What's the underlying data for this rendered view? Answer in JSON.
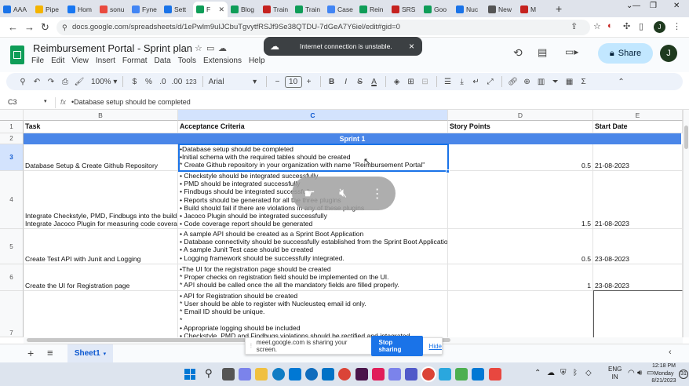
{
  "browser": {
    "tabs": [
      {
        "label": "AAA",
        "color": "#1a73e8"
      },
      {
        "label": "Pipe",
        "color": "#f4b400"
      },
      {
        "label": "Hom",
        "color": "#1877f2"
      },
      {
        "label": "sonu",
        "color": "#e94a3f"
      },
      {
        "label": "Fyne",
        "color": "#4285f4"
      },
      {
        "label": "Sett",
        "color": "#1a73e8"
      },
      {
        "label": "F",
        "color": "#0f9d58",
        "active": true
      },
      {
        "label": "Blog",
        "color": "#0f9d58"
      },
      {
        "label": "Train",
        "color": "#c5221f"
      },
      {
        "label": "Train",
        "color": "#0f9d58"
      },
      {
        "label": "Case",
        "color": "#4285f4"
      },
      {
        "label": "Rein",
        "color": "#0f9d58"
      },
      {
        "label": "SRS",
        "color": "#c5221f"
      },
      {
        "label": "Goo",
        "color": "#0f9d58"
      },
      {
        "label": "Nuc",
        "color": "#1a73e8"
      },
      {
        "label": "New",
        "color": "#555555"
      },
      {
        "label": "M",
        "color": "#c5221f"
      }
    ],
    "new_tab": "+",
    "url": "docs.google.com/spreadsheets/d/1ePwlm9uIJCbuTgvytfRSJf9Se38QTDU-7dGeA7Y6iel/edit#gid=0"
  },
  "toast": {
    "message": "Internet connection is unstable.",
    "close": "×"
  },
  "sheets": {
    "title": "Reimbursement Portal - Sprint plan",
    "menu": [
      "File",
      "Edit",
      "View",
      "Insert",
      "Format",
      "Data",
      "Tools",
      "Extensions",
      "Help"
    ],
    "share_label": "Share",
    "avatar_letter": "J"
  },
  "toolbar": {
    "zoom": "100%",
    "currency": "$",
    "percent": "%",
    "dec_less": ".0",
    "dec_more": ".00",
    "num_format": "123",
    "font": "Arial",
    "font_size": "10",
    "bold": "B",
    "italic": "I",
    "text_color_a": "A"
  },
  "formula_bar": {
    "cell_ref": "C3",
    "fx": "fx",
    "content": "•Database setup should be completed"
  },
  "grid": {
    "columns": [
      {
        "id": "B",
        "selected": false
      },
      {
        "id": "C",
        "selected": true
      },
      {
        "id": "D",
        "selected": false
      },
      {
        "id": "E",
        "selected": false
      }
    ],
    "row_numbers": [
      "1",
      "2",
      "3",
      "4",
      "5",
      "6",
      "7"
    ],
    "headers": {
      "task": "Task",
      "criteria": "Acceptance Criteria",
      "points": "Story Points",
      "date": "Start Date"
    },
    "sprint_label": "Sprint 1",
    "rows": [
      {
        "task": "Database Setup & Create Github Repository",
        "criteria": "•Database setup should be completed\n•Initial schema with the required tables should be created\n* Create Github repository in your organization with name \"Reimbursement Portal\"",
        "points": "0.5",
        "date": "21-08-2023"
      },
      {
        "task": "Integrate Checkstyle, PMD, Findbugs into the build\nIntegrate Jacoco Plugin for measuring code covera",
        "criteria": "• Checkstyle should be integrated successfully\n• PMD should be integrated successfully\n• Findbugs should be integrated successfully\n• Reports should be generated for all the three plugins\n• Build should fail if there are violations in any of these plugins\n• Jacoco Plugin should be integrated successfully\n• Code coverage report should be generated",
        "points": "1.5",
        "date": "21-08-2023"
      },
      {
        "task": "Create Test API with Junit and Logging",
        "criteria": "• A sample API should be created as a Sprint Boot Application\n• Database connectivity should be successfully established from the Sprint Boot Applicatio\n• A sample Junit Test case should be created\n• Logging framework should be successfully integrated.",
        "points": "0.5",
        "date": "23-08-2023"
      },
      {
        "task": "Create the UI for Registration page",
        "criteria": "•The UI for the registration page should be created\n* Proper checks on registration field should be implemented on the UI.\n* API should be called once the all the mandatory fields are filled properly.",
        "points": "1",
        "date": "23-08-2023"
      },
      {
        "task": "",
        "criteria": "• API for Registration should be created\n* User should be able to register with Nucleusteq email id only.\n* Email ID should be unique.\n*\n• Appropriate logging should be included\n• Checkstyle, PMD and Findbugs violations should be rectified and integrated",
        "points": "",
        "date": ""
      }
    ]
  },
  "sheet_tabs": {
    "add": "+",
    "all_sheets": "≡",
    "active": "Sheet1"
  },
  "meet_share": {
    "message": "meet.google.com is sharing your screen.",
    "stop_label": "Stop sharing",
    "hide_label": "Hide"
  },
  "taskbar": {
    "lang": "ENG",
    "region": "IN",
    "time": "12:18 PM",
    "day": "Monday",
    "date": "8/21/2023",
    "notif_count": "31"
  }
}
